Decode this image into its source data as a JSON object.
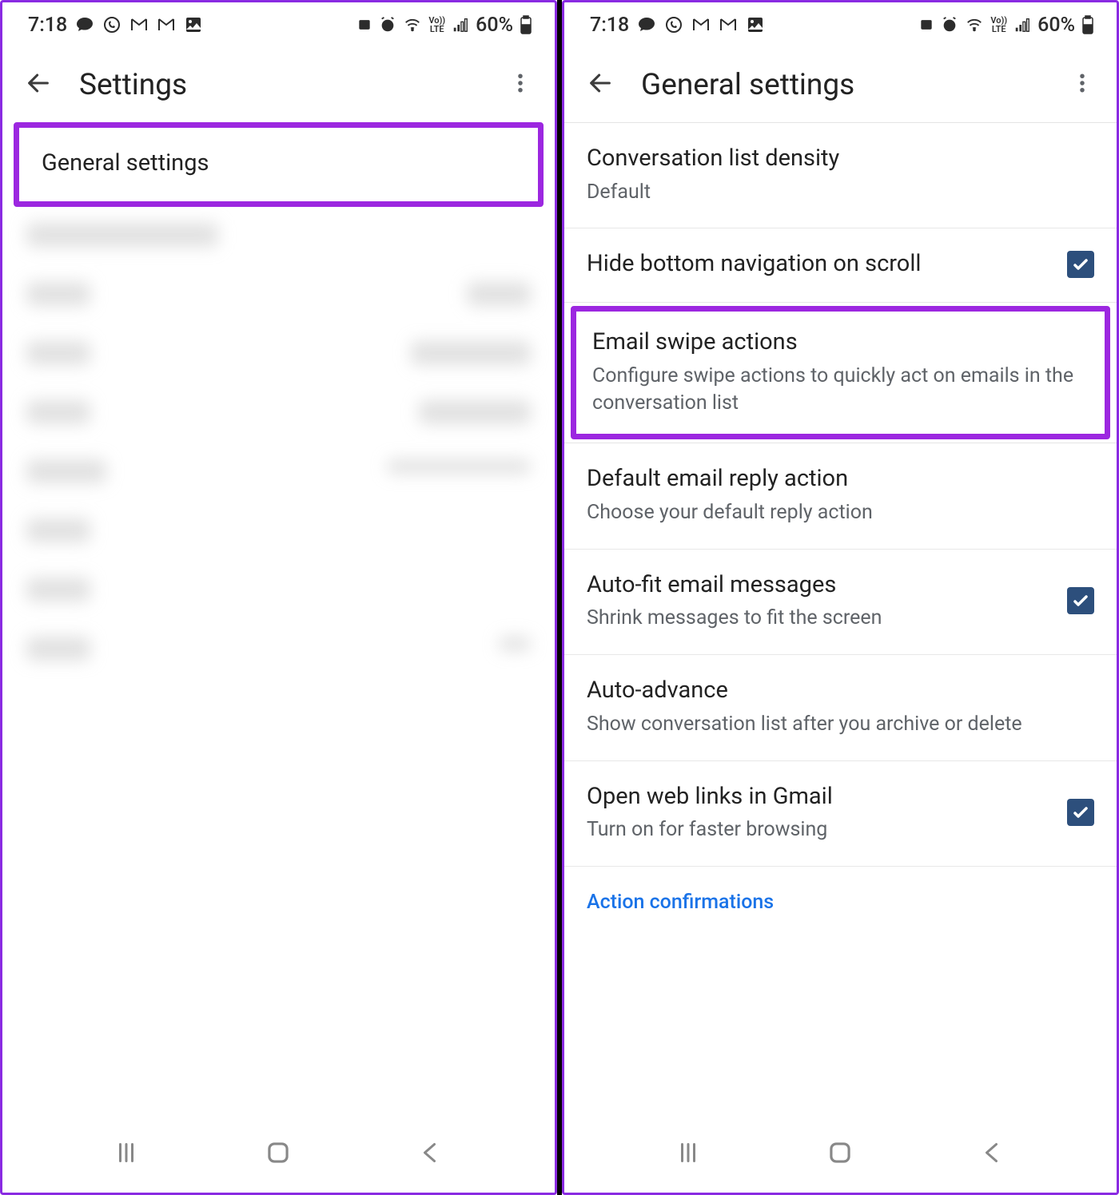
{
  "status": {
    "time": "7:18",
    "battery": "60%"
  },
  "left_screen": {
    "title": "Settings",
    "general_settings_label": "General settings"
  },
  "right_screen": {
    "title": "General settings",
    "items": {
      "density": {
        "title": "Conversation list density",
        "sub": "Default"
      },
      "hide_nav": {
        "title": "Hide bottom navigation on scroll"
      },
      "swipe": {
        "title": "Email swipe actions",
        "sub": "Configure swipe actions to quickly act on emails in the conversation list"
      },
      "reply": {
        "title": "Default email reply action",
        "sub": "Choose your default reply action"
      },
      "autofit": {
        "title": "Auto-fit email messages",
        "sub": "Shrink messages to fit the screen"
      },
      "autoadv": {
        "title": "Auto-advance",
        "sub": "Show conversation list after you archive or delete"
      },
      "weblinks": {
        "title": "Open web links in Gmail",
        "sub": "Turn on for faster browsing"
      }
    },
    "section_header": "Action confirmations"
  }
}
